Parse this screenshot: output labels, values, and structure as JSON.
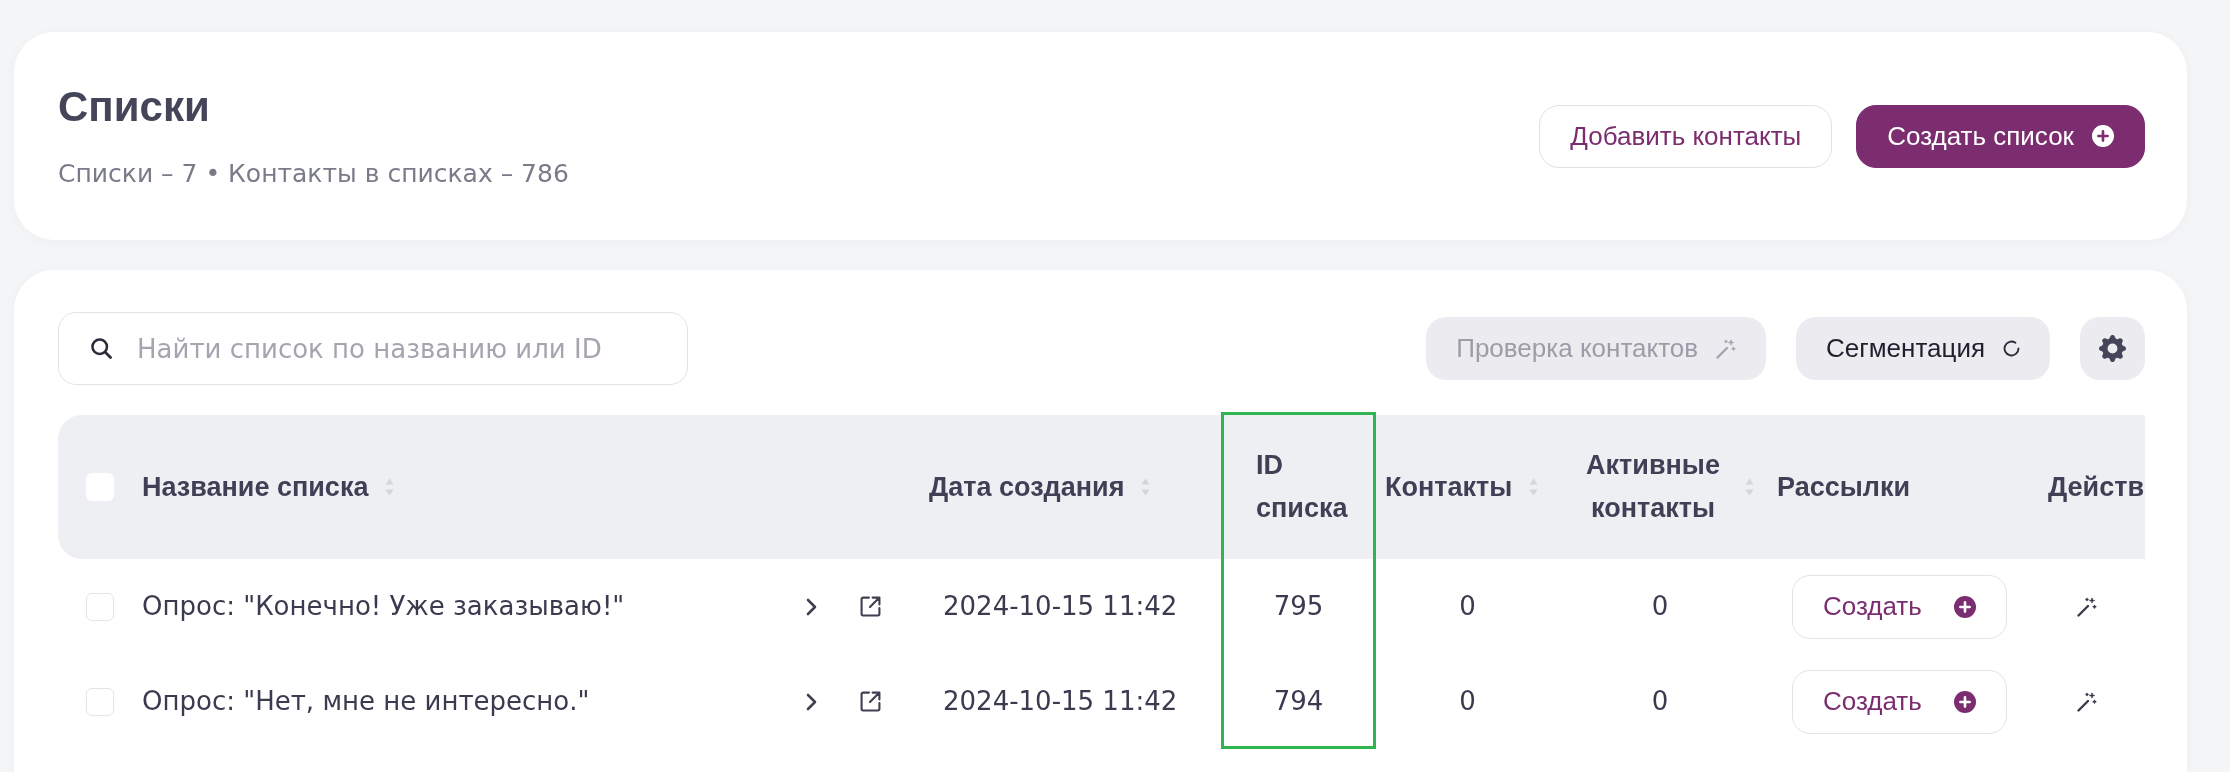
{
  "header": {
    "title": "Списки",
    "summary": "Списки – 7 • Контакты в списках – 786",
    "actions": [
      {
        "label": "Добавить контакты",
        "kind": "outline"
      },
      {
        "label": "Создать список",
        "kind": "primary"
      }
    ]
  },
  "toolbar": {
    "search": {
      "placeholder": "Найти список по названию или ID"
    },
    "buttons": [
      {
        "label": "Проверка контактов",
        "kind": "check",
        "disabled": true
      },
      {
        "label": "Сегментация",
        "kind": "segment",
        "disabled": false
      },
      {
        "kind": "settings",
        "disabled": false
      }
    ]
  },
  "table": {
    "select_all": {
      "checked": false
    },
    "columns": [
      {
        "label": "Название списка",
        "sortable": true,
        "highlighted": false
      },
      {
        "label": "Дата создания",
        "sortable": true,
        "highlighted": false
      },
      {
        "label": "ID списка",
        "sortable": false,
        "highlighted": true
      },
      {
        "label": "Контакты",
        "sortable": true,
        "highlighted": false
      },
      {
        "label": "Активные контакты",
        "sortable": true,
        "highlighted": false
      },
      {
        "label": "Рассылки",
        "sortable": false,
        "highlighted": false
      },
      {
        "label": "Действ",
        "sortable": false,
        "highlighted": false
      }
    ],
    "rows": [
      {
        "checked": false,
        "name": "Опрос: \"Конечно! Уже заказываю!\"",
        "created": "2024-10-15 11:42",
        "list_id": "795",
        "contacts": "0",
        "active_contacts": "0",
        "mailing_button": "Создать"
      },
      {
        "checked": false,
        "name": "Опрос: \"Нет, мне не интересно.\"",
        "created": "2024-10-15 11:42",
        "list_id": "794",
        "contacts": "0",
        "active_contacts": "0",
        "mailing_button": "Создать"
      }
    ]
  }
}
